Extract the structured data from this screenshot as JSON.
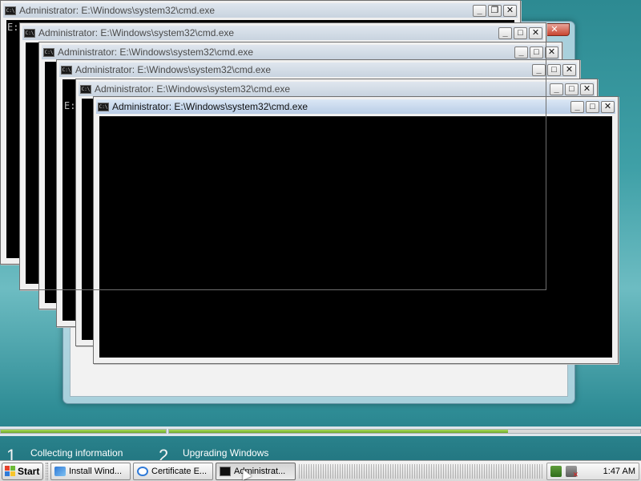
{
  "windows": {
    "cmd_title": "Administrator: E:\\Windows\\system32\\cmd.exe",
    "cmd_prompt_fragment": "E:\\",
    "cmd_prompt_fragment_2": "E:"
  },
  "progress": {
    "segments": [
      {
        "name": "collecting-information",
        "fraction": 1.0
      },
      {
        "name": "upgrading-windows",
        "fraction": 0.72
      }
    ]
  },
  "setup_steps": [
    {
      "number": "1",
      "label": "Collecting information"
    },
    {
      "number": "2",
      "label": "Upgrading Windows"
    }
  ],
  "taskbar": {
    "start_label": "Start",
    "tasks": [
      {
        "label": "Install Wind...",
        "icon": "setup-icon"
      },
      {
        "label": "Certificate E...",
        "icon": "ie-icon"
      },
      {
        "label": "Administrat...",
        "icon": "cmd-icon"
      }
    ],
    "clock": "1:47 AM"
  },
  "colors": {
    "console_bg": "#000000",
    "progress_green": "#8cc63f",
    "desktop": "#3a9aa2"
  },
  "buttons": {
    "minimize": "_",
    "maximize": "□",
    "restore": "❐",
    "close": "✕"
  }
}
